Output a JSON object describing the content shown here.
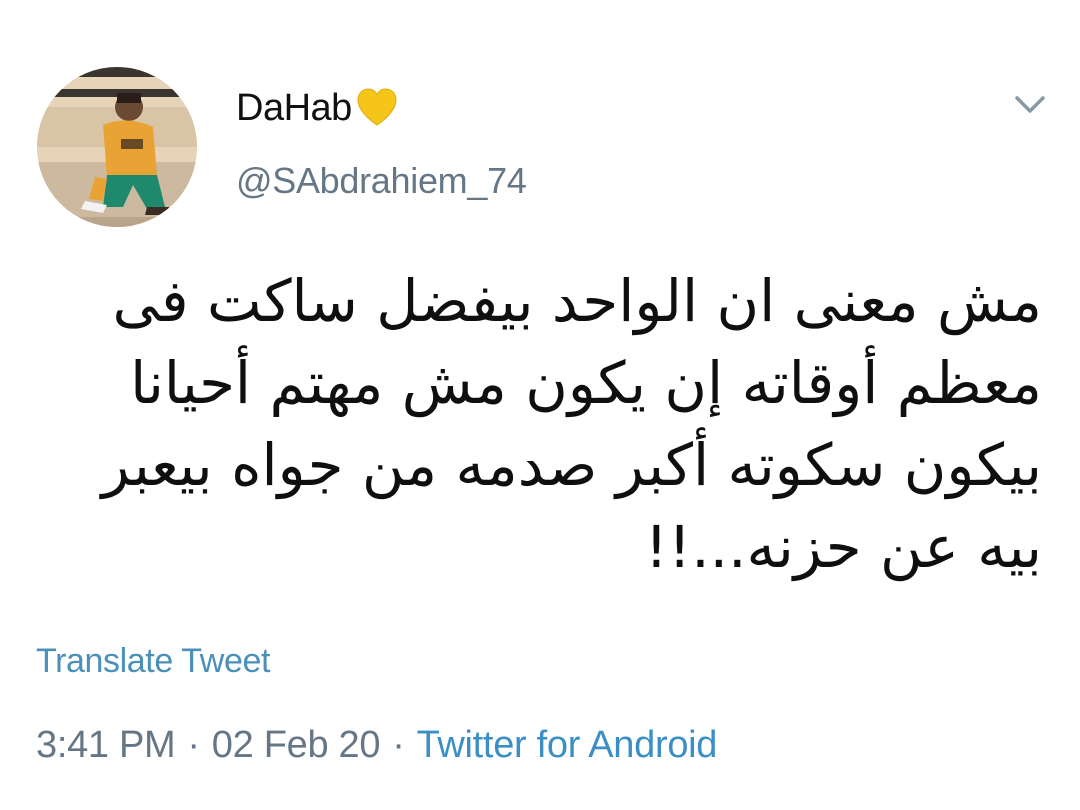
{
  "tweet": {
    "author": {
      "display_name": "DaHab",
      "badge_icon": "yellow-heart-icon",
      "handle": "@SAbdrahiem_74"
    },
    "menu_icon": "chevron-down-icon",
    "text": "مش معنى ان الواحد بيفضل ساكت فى\nمعظم أوقاته إن يكون مش مهتم أحيانا\nبيكون سكوته أكبر صدمه من جواه بيعبر\nبيه عن حزنه...!!",
    "translate_label": "Translate Tweet",
    "time": "3:41 PM",
    "date": "02 Feb 20",
    "separator": "·",
    "source": "Twitter for Android"
  },
  "colors": {
    "link": "#3b8fc4",
    "secondary_text": "#657786",
    "heart": "#f5c518"
  }
}
